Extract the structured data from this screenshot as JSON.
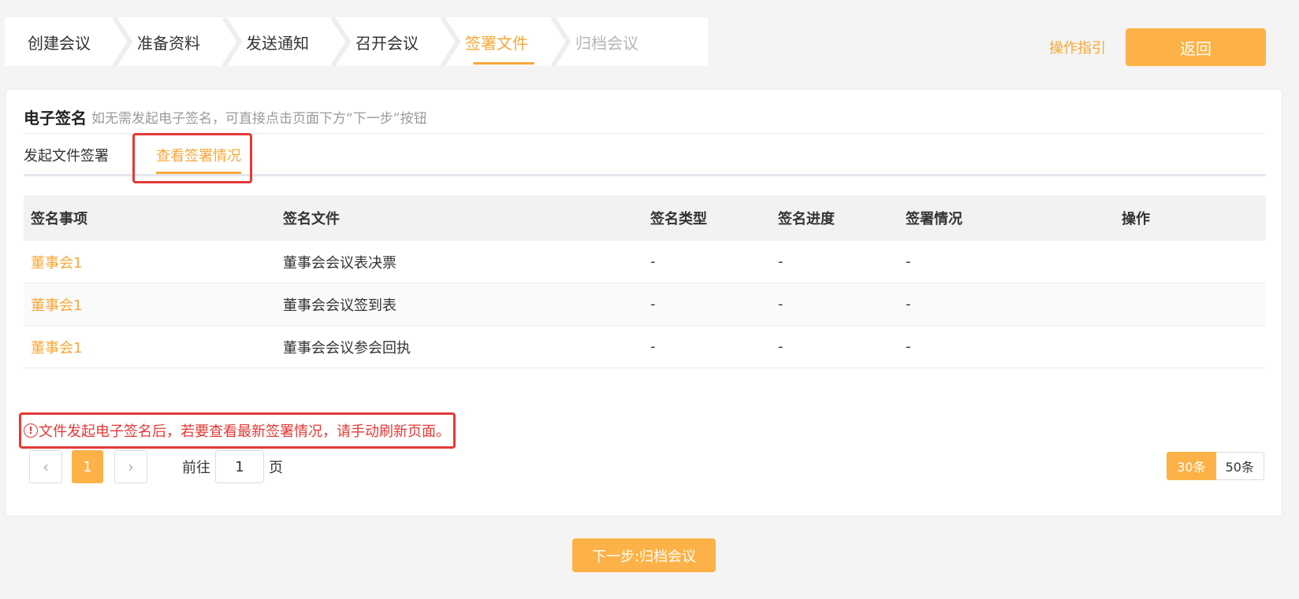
{
  "steps": [
    {
      "label": "创建会议",
      "state": "done"
    },
    {
      "label": "准备资料",
      "state": "done"
    },
    {
      "label": "发送通知",
      "state": "done"
    },
    {
      "label": "召开会议",
      "state": "done"
    },
    {
      "label": "签署文件",
      "state": "active"
    },
    {
      "label": "归档会议",
      "state": "disabled"
    }
  ],
  "header": {
    "guide_label": "操作指引",
    "back_label": "返回"
  },
  "card": {
    "title": "电子签名",
    "hint": "如无需发起电子签名，可直接点击页面下方“下一步”按钮"
  },
  "tabs": [
    {
      "label": "发起文件签署",
      "active": false
    },
    {
      "label": "查看签署情况",
      "active": true
    }
  ],
  "table": {
    "columns": [
      "签名事项",
      "签名文件",
      "签名类型",
      "签名进度",
      "签署情况",
      "操作"
    ],
    "rows": [
      {
        "item": "董事会1",
        "file": "董事会会议表决票",
        "type": "-",
        "progress": "-",
        "status": "-",
        "action": ""
      },
      {
        "item": "董事会1",
        "file": "董事会会议签到表",
        "type": "-",
        "progress": "-",
        "status": "-",
        "action": ""
      },
      {
        "item": "董事会1",
        "file": "董事会会议参会回执",
        "type": "-",
        "progress": "-",
        "status": "-",
        "action": ""
      }
    ]
  },
  "warning": {
    "icon": "exclamation-circle-icon",
    "text": "文件发起电子签名后，若要查看最新签署情况，请手动刷新页面。"
  },
  "pagination": {
    "current_page": "1",
    "goto_label": "前往",
    "goto_value": "1",
    "page_unit": "页",
    "sizes": [
      "30条",
      "50条"
    ],
    "active_size": "30条"
  },
  "footer": {
    "next_label": "下一步:归档会议"
  },
  "colors": {
    "accent": "#f7a838",
    "button": "#fcb246",
    "danger": "#e53935"
  }
}
